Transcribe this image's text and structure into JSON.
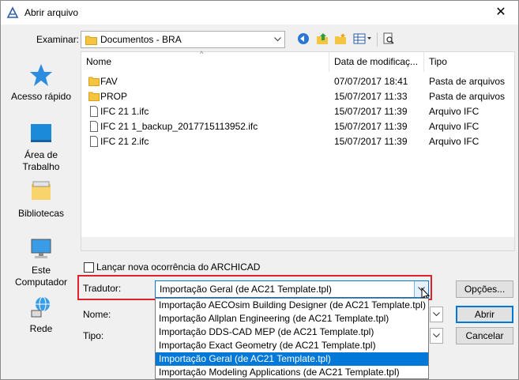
{
  "window": {
    "title": "Abrir arquivo",
    "close_glyph": "✕"
  },
  "lookin": {
    "label": "Examinar:",
    "value": "Documentos - BRA"
  },
  "toolbar": {
    "icons": [
      "back-icon",
      "up-folder-icon",
      "new-folder-icon",
      "view-menu-icon",
      "preview-icon"
    ]
  },
  "places": [
    {
      "label": "Acesso rápido",
      "icon": "star-icon"
    },
    {
      "label": "Área de\nTrabalho",
      "icon": "desktop-icon"
    },
    {
      "label": "Bibliotecas",
      "icon": "libraries-icon"
    },
    {
      "label": "Este\nComputador",
      "icon": "computer-icon"
    },
    {
      "label": "Rede",
      "icon": "network-icon"
    }
  ],
  "columns": {
    "name": "Nome",
    "date": "Data de modificaç...",
    "type": "Tipo"
  },
  "files": [
    {
      "name": "FAV",
      "date": "07/07/2017 18:41",
      "type": "Pasta de arquivos",
      "kind": "folder"
    },
    {
      "name": "PROP",
      "date": "15/07/2017 11:33",
      "type": "Pasta de arquivos",
      "kind": "folder"
    },
    {
      "name": "IFC 21 1.ifc",
      "date": "15/07/2017 11:39",
      "type": "Arquivo IFC",
      "kind": "file"
    },
    {
      "name": "IFC 21 1_backup_2017715113952.ifc",
      "date": "15/07/2017 11:39",
      "type": "Arquivo IFC",
      "kind": "file"
    },
    {
      "name": "IFC 21 2.ifc",
      "date": "15/07/2017 11:39",
      "type": "Arquivo IFC",
      "kind": "file"
    }
  ],
  "new_instance": {
    "label": "Lançar nova ocorrência do ARCHICAD",
    "checked": false
  },
  "translator": {
    "label": "Tradutor:",
    "value": "Importação Geral (de AC21 Template.tpl)",
    "options": [
      "Importação AECOsim Building Designer (de AC21 Template.tpl)",
      "Importação Allplan Engineering (de AC21 Template.tpl)",
      "Importação DDS-CAD MEP (de AC21 Template.tpl)",
      "Importação Exact Geometry (de AC21 Template.tpl)",
      "Importação Geral (de AC21 Template.tpl)",
      "Importação Modeling Applications (de AC21 Template.tpl)"
    ],
    "selected_index": 4
  },
  "name_field": {
    "label": "Nome:"
  },
  "type_field": {
    "label": "Tipo:"
  },
  "buttons": {
    "options": "Opções...",
    "open": "Abrir",
    "cancel": "Cancelar"
  },
  "colors": {
    "accent": "#0078d7",
    "highlight_border": "#e0222a",
    "folder": "#f5c542"
  }
}
